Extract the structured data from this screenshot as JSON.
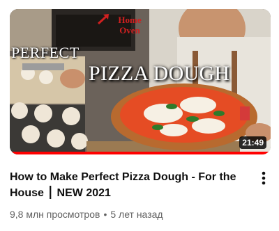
{
  "video": {
    "thumbnail": {
      "overlay_perfect": "PERFECT",
      "overlay_pizza": "PIZZA DOUGH",
      "overlay_home_line1": "Home",
      "overlay_home_line2": "Oven",
      "duration": "21:49",
      "watch_progress": 1.0
    },
    "title": "How to Make Perfect Pizza Dough - For the House ⎮ NEW 2021",
    "views": "9,8 млн просмотров",
    "separator": "•",
    "age": "5 лет назад",
    "more_icon": "vertical-dots-icon"
  },
  "colors": {
    "title": "#0f0f0f",
    "meta": "#606060",
    "progress": "#ff0000",
    "overlay_red_text": "#d02020"
  }
}
